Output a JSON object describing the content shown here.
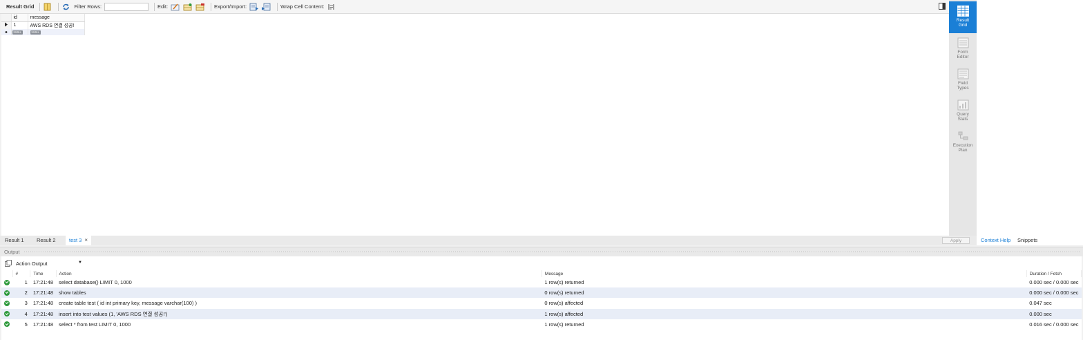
{
  "toolbar": {
    "result_grid_label": "Result Grid",
    "filter_rows_label": "Filter Rows:",
    "filter_rows_value": "",
    "edit_label": "Edit:",
    "export_import_label": "Export/Import:",
    "wrap_cell_label": "Wrap Cell Content:"
  },
  "grid": {
    "columns": [
      "id",
      "message"
    ],
    "rows": [
      {
        "id": "1",
        "message": "AWS RDS 연결 성공!"
      }
    ],
    "new_row": {
      "id": "NULL",
      "message": "NULL"
    }
  },
  "side_panel": {
    "items": [
      {
        "label": "Result\nGrid",
        "icon": "result-grid-icon",
        "active": true
      },
      {
        "label": "Form\nEditor",
        "icon": "form-editor-icon",
        "active": false
      },
      {
        "label": "Field\nTypes",
        "icon": "field-types-icon",
        "active": false
      },
      {
        "label": "Query\nStats",
        "icon": "query-stats-icon",
        "active": false
      },
      {
        "label": "Execution\nPlan",
        "icon": "execution-plan-icon",
        "active": false
      }
    ]
  },
  "result_tabs": [
    {
      "label": "Result 1",
      "active": false
    },
    {
      "label": "Result 2",
      "active": false
    },
    {
      "label": "test 3",
      "active": true,
      "close": "×"
    }
  ],
  "apply_label": "Apply",
  "context_tabs": {
    "context_help": "Context Help",
    "snippets": "Snippets"
  },
  "output": {
    "title": "Output",
    "selector": "Action Output",
    "columns": [
      "#",
      "Time",
      "Action",
      "Message",
      "Duration / Fetch"
    ],
    "rows": [
      {
        "n": "1",
        "time": "17:21:48",
        "action": "select database() LIMIT 0, 1000",
        "message": "1 row(s) returned",
        "duration": "0.000 sec / 0.000 sec"
      },
      {
        "n": "2",
        "time": "17:21:48",
        "action": "show tables",
        "message": "0 row(s) returned",
        "duration": "0.000 sec / 0.000 sec"
      },
      {
        "n": "3",
        "time": "17:21:48",
        "action": "create table test ( id int primary key, message varchar(100) )",
        "message": "0 row(s) affected",
        "duration": "0.047 sec"
      },
      {
        "n": "4",
        "time": "17:21:48",
        "action": "insert into test values (1, 'AWS RDS 연결 성공!')",
        "message": "1 row(s) affected",
        "duration": "0.000 sec"
      },
      {
        "n": "5",
        "time": "17:21:48",
        "action": "select * from test LIMIT 0, 1000",
        "message": "1 row(s) returned",
        "duration": "0.016 sec / 0.000 sec"
      }
    ]
  },
  "colors": {
    "accent": "#1a7fd6",
    "success": "#2f9a3c",
    "alt_row": "#e8edf7"
  }
}
